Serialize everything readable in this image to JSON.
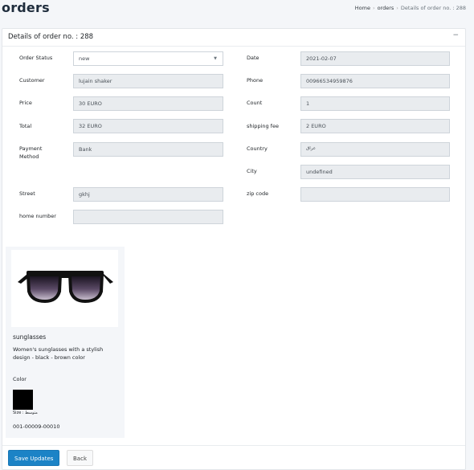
{
  "page": {
    "title": "orders"
  },
  "breadcrumb": {
    "items": [
      "Home",
      "orders",
      "Details of order no. : 288"
    ],
    "sep": "›"
  },
  "card": {
    "title": "Details of order no. : 288",
    "collapse_symbol": "−"
  },
  "form": {
    "order_status": {
      "label": "Order Status",
      "value": "new",
      "caret": "▼"
    },
    "date": {
      "label": "Date",
      "value": "2021-02-07"
    },
    "customer": {
      "label": "Customer",
      "value": "lujain shaker"
    },
    "phone": {
      "label": "Phone",
      "value": "00966534959876"
    },
    "price": {
      "label": "Price",
      "value": "30 EURO"
    },
    "count": {
      "label": "Count",
      "value": "1"
    },
    "total": {
      "label": "Total",
      "value": "32 EURO"
    },
    "shipping_fee": {
      "label": "shipping fee",
      "value": "2 EURO"
    },
    "payment_method": {
      "label": "Payment Method",
      "value": "Bank"
    },
    "country": {
      "label": "Country",
      "value": "عراق"
    },
    "city": {
      "label": "City",
      "value": "undefined"
    },
    "street": {
      "label": "Street",
      "value": "gkhj"
    },
    "zip_code": {
      "label": "zip code",
      "value": ""
    },
    "home_number": {
      "label": "home number",
      "value": ""
    }
  },
  "product": {
    "name": "sunglasses",
    "description": "Women's sunglasses with a stylish design - black - brown color",
    "color_label": "Color",
    "color_value": "#000000",
    "size_label": "Size : متوسط",
    "sku": "001-00009-00010"
  },
  "footer": {
    "save_label": "Save Updates",
    "back_label": "Back"
  }
}
